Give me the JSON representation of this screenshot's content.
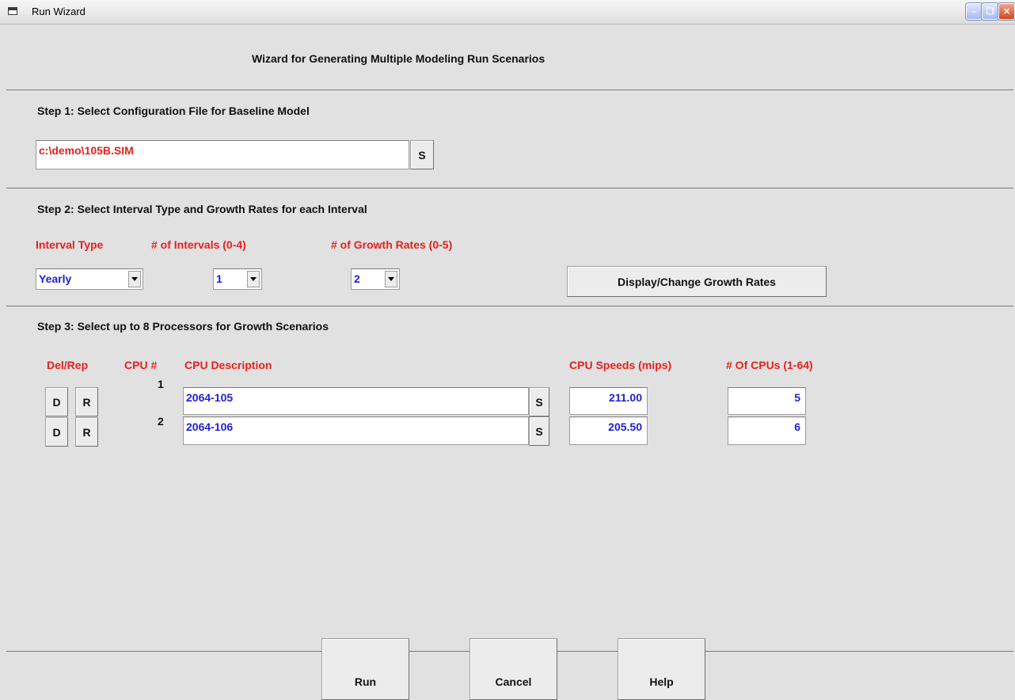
{
  "window": {
    "title": "Run Wizard"
  },
  "heading": "Wizard for Generating Multiple Modeling Run Scenarios",
  "step1": {
    "title": "Step 1: Select Configuration File for Baseline Model",
    "file_value": "c:\\demo\\105B.SIM",
    "select_label": "S"
  },
  "step2": {
    "title": "Step 2: Select Interval Type and Growth Rates for each Interval",
    "interval_type_label": "Interval Type",
    "intervals_label": "# of Intervals (0-4)",
    "growth_rates_label": "# of Growth Rates (0-5)",
    "interval_type_value": "Yearly",
    "intervals_value": "1",
    "growth_rates_value": "2",
    "display_change_label": "Display/Change Growth Rates"
  },
  "step3": {
    "title": "Step 3: Select up to 8 Processors for Growth Scenarios",
    "columns": {
      "del_rep": "Del/Rep",
      "cpu_num": "CPU #",
      "cpu_desc": "CPU Description",
      "cpu_speed": "CPU Speeds (mips)",
      "num_cpus": "# Of CPUs (1-64)"
    },
    "rows": [
      {
        "del": "D",
        "rep": "R",
        "num": "1",
        "desc": "2064-105",
        "select": "S",
        "speed": "211.00",
        "count": "5"
      },
      {
        "del": "D",
        "rep": "R",
        "num": "2",
        "desc": "2064-106",
        "select": "S",
        "speed": "205.50",
        "count": "6"
      }
    ]
  },
  "footer": {
    "run": "Run",
    "cancel": "Cancel",
    "help": "Help"
  },
  "colors": {
    "label_red": "#e8201c",
    "value_blue": "#1f1fd8",
    "background": "#e1e1e1"
  }
}
